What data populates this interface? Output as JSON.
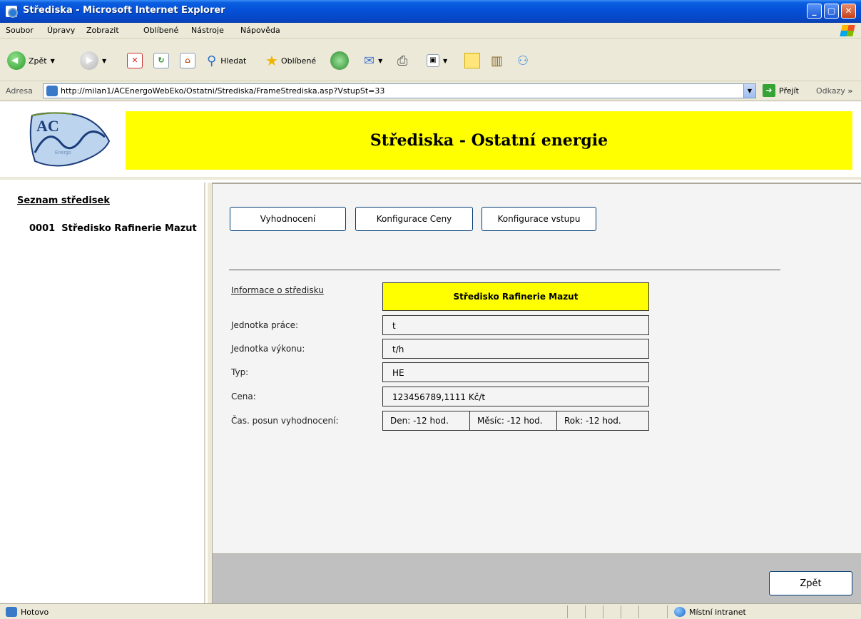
{
  "window": {
    "title": "Střediska - Microsoft Internet Explorer",
    "minimize": "_",
    "maximize": "▢",
    "close": "✕"
  },
  "menu": [
    "Soubor",
    "Úpravy",
    "Zobrazit",
    "Oblíbené",
    "Nástroje",
    "Nápověda"
  ],
  "toolbar": {
    "back": "Zpět",
    "search": "Hledat",
    "favorites": "Oblíbené"
  },
  "address": {
    "label": "Adresa",
    "url": "http://milan1/ACEnergoWebEko/Ostatni/Strediska/FrameStrediska.asp?VstupSt=33",
    "go": "Přejít",
    "links": "Odkazy"
  },
  "header": {
    "logo_text": "AC",
    "logo_sub": "Energo",
    "banner": "Střediska - Ostatní energie"
  },
  "left": {
    "heading": "Seznam středisek",
    "items": [
      {
        "code": "0001",
        "name": "Středisko Rafinerie Mazut"
      }
    ]
  },
  "main": {
    "buttons": [
      "Vyhodnocení",
      "Konfigurace Ceny",
      "Konfigurace vstupu"
    ],
    "info_label": "Informace o středisku",
    "info_title": "Středisko Rafinerie Mazut",
    "rows": [
      {
        "label": "Jednotka práce:",
        "value": "t"
      },
      {
        "label": "Jednotka výkonu:",
        "value": "t/h"
      },
      {
        "label": "Typ:",
        "value": "HE"
      },
      {
        "label": "Cena:",
        "value": "123456789,1111 Kč/t"
      }
    ],
    "shift_label": "Čas. posun vyhodnocení:",
    "shift": {
      "den": "Den: -12 hod.",
      "mesic": "Měsíc: -12 hod.",
      "rok": "Rok: -12 hod."
    }
  },
  "bottom": {
    "back_button": "Zpět"
  },
  "status": {
    "text": "Hotovo",
    "zone": "Místní intranet"
  }
}
